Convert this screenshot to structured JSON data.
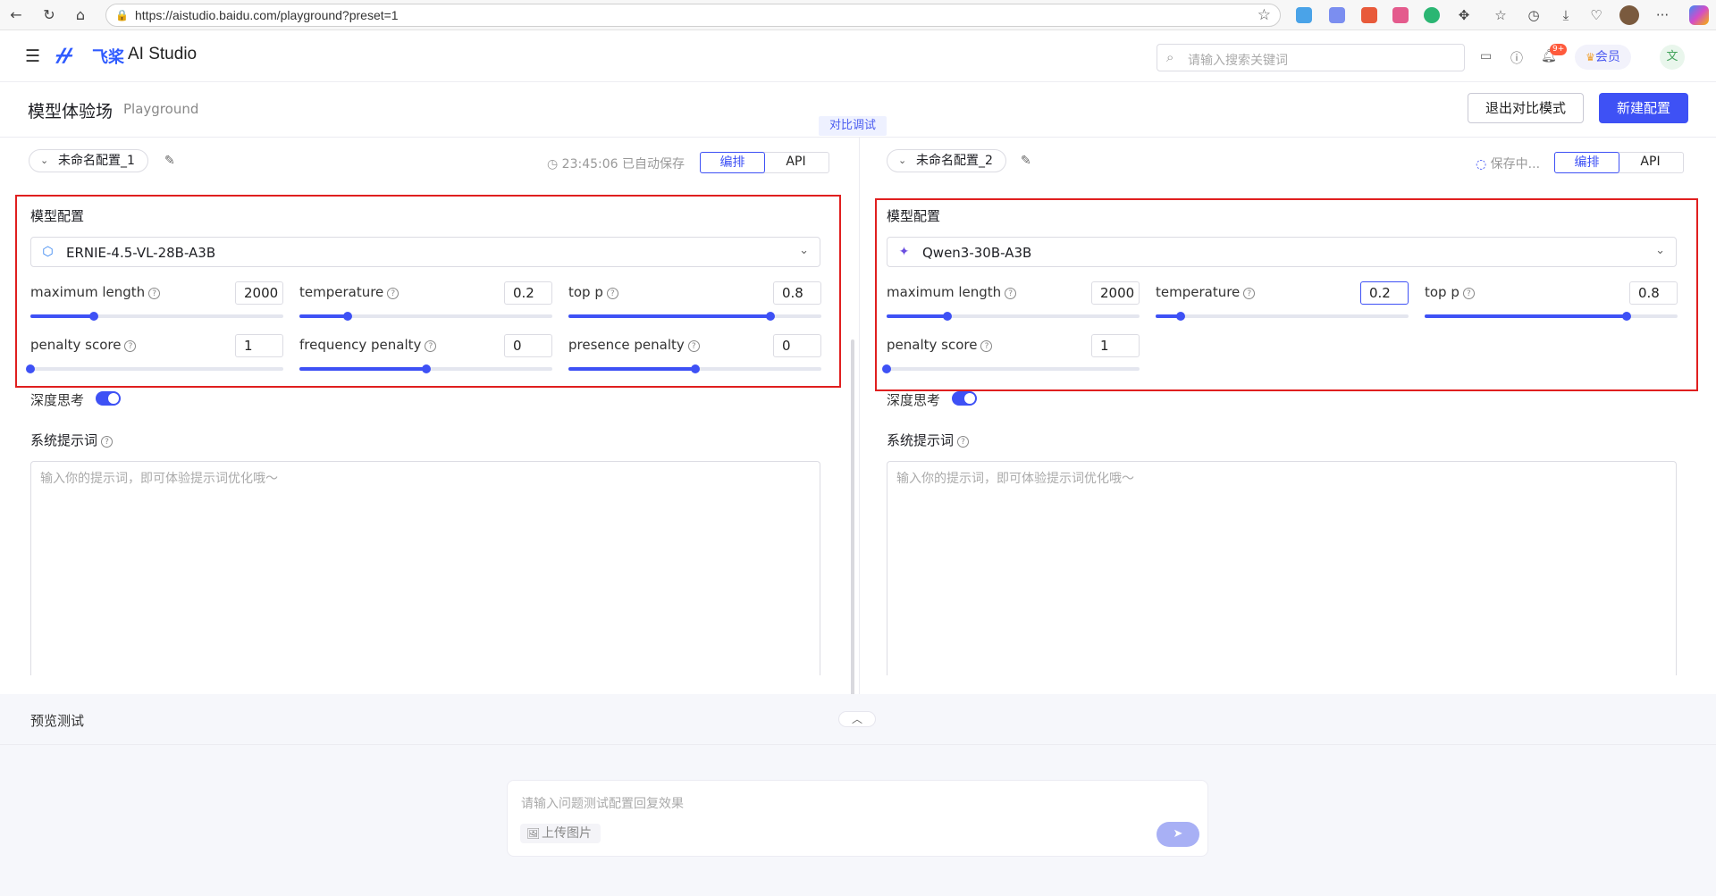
{
  "browser": {
    "url": "https://aistudio.baidu.com/playground?preset=1"
  },
  "header": {
    "logo_mark": "ᚋᚋ",
    "logo_cn": "飞桨",
    "logo_text": "AI Studio",
    "search_placeholder": "请输入搜索关键词",
    "notification_badge": "9+",
    "vip_label": "会员",
    "avatar_text": "文"
  },
  "page": {
    "title": "模型体验场",
    "subtitle": "Playground",
    "compare_tag": "对比调试",
    "exit_compare": "退出对比模式",
    "new_config": "新建配置"
  },
  "panels": [
    {
      "config_name": "未命名配置_1",
      "save_status": "23:45:06 已自动保存",
      "tabs": [
        "编排",
        "API"
      ],
      "model_section": "模型配置",
      "model_name": "ERNIE-4.5-VL-28B-A3B",
      "params": [
        {
          "label": "maximum length",
          "value": "2000",
          "fraction": 0.25
        },
        {
          "label": "temperature",
          "value": "0.2",
          "fraction": 0.19
        },
        {
          "label": "top p",
          "value": "0.8",
          "fraction": 0.8
        },
        {
          "label": "penalty score",
          "value": "1",
          "fraction": 0.0
        },
        {
          "label": "frequency penalty",
          "value": "0",
          "fraction": 0.5
        },
        {
          "label": "presence penalty",
          "value": "0",
          "fraction": 0.5
        }
      ],
      "deep_think": "深度思考",
      "system_prompt_label": "系统提示词",
      "system_prompt_placeholder": "输入你的提示词，即可体验提示词优化哦～"
    },
    {
      "config_name": "未命名配置_2",
      "save_status": "保存中...",
      "tabs": [
        "编排",
        "API"
      ],
      "model_section": "模型配置",
      "model_name": "Qwen3-30B-A3B",
      "params": [
        {
          "label": "maximum length",
          "value": "2000",
          "fraction": 0.24
        },
        {
          "label": "temperature",
          "value": "0.2",
          "fraction": 0.1
        },
        {
          "label": "top p",
          "value": "0.8",
          "fraction": 0.8
        },
        {
          "label": "penalty score",
          "value": "1",
          "fraction": 0.0
        }
      ],
      "deep_think": "深度思考",
      "system_prompt_label": "系统提示词",
      "system_prompt_placeholder": "输入你的提示词，即可体验提示词优化哦～"
    }
  ],
  "preview": {
    "title": "预览测试",
    "input_placeholder": "请输入问题测试配置回复效果",
    "upload_label": "上传图片"
  },
  "colors": {
    "accent": "#3e51f5",
    "highlight_box": "#e01f1f"
  }
}
